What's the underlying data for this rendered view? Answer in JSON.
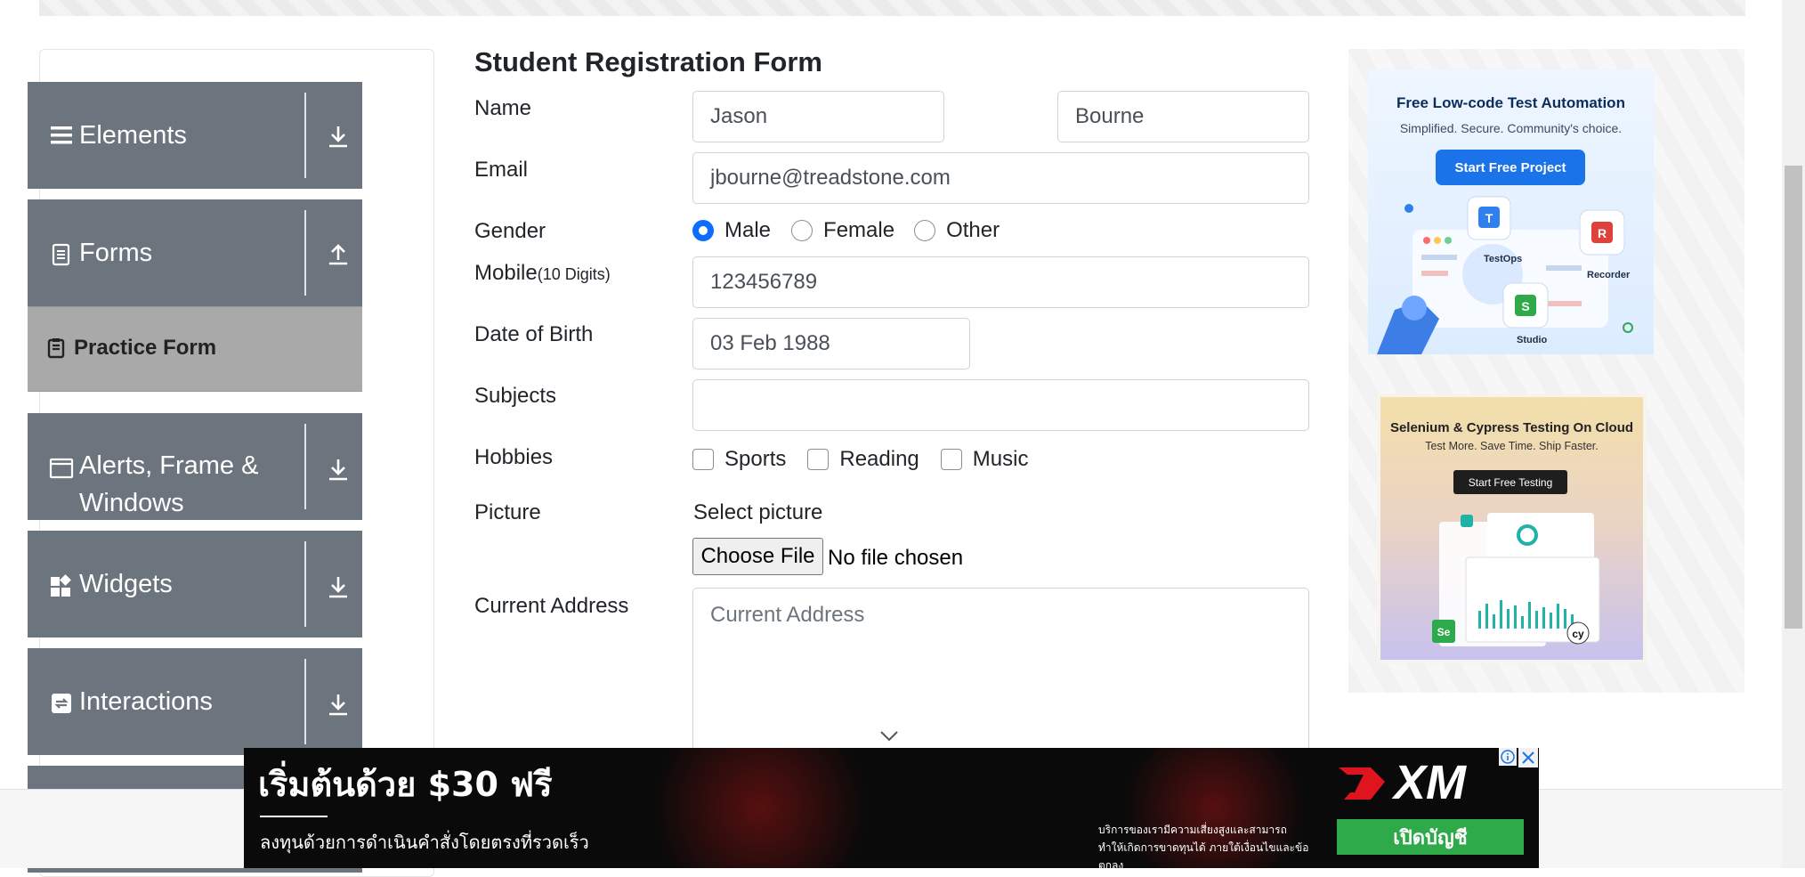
{
  "sidebar": {
    "groups": [
      {
        "label": "Elements",
        "icon": "hamburger-icon",
        "arrow": "download-arrow-icon"
      },
      {
        "label": "Forms",
        "icon": "document-icon",
        "arrow": "upload-arrow-icon"
      },
      {
        "label": "Alerts, Frame & Windows",
        "icon": "window-icon",
        "arrow": "download-arrow-icon"
      },
      {
        "label": "Widgets",
        "icon": "widgets-icon",
        "arrow": "download-arrow-icon"
      },
      {
        "label": "Interactions",
        "icon": "interactions-icon",
        "arrow": "download-arrow-icon"
      }
    ],
    "forms_items": [
      {
        "label": "Practice Form",
        "icon": "clipboard-icon",
        "active": true
      }
    ],
    "alerts_line1": "Alerts, Frame &",
    "alerts_line2": "Windows"
  },
  "form": {
    "title": "Student Registration Form",
    "labels": {
      "name": "Name",
      "email": "Email",
      "gender": "Gender",
      "mobile": "Mobile",
      "mobile_hint": "(10 Digits)",
      "dob": "Date of Birth",
      "subjects": "Subjects",
      "hobbies": "Hobbies",
      "picture": "Picture",
      "address": "Current Address"
    },
    "first_name": "Jason",
    "last_name": "Bourne",
    "email": "jbourne@treadstone.com",
    "gender_options": [
      "Male",
      "Female",
      "Other"
    ],
    "gender_selected": "Male",
    "mobile": "123456789",
    "dob": "03 Feb 1988",
    "subjects": "",
    "hobbies": [
      "Sports",
      "Reading",
      "Music"
    ],
    "select_picture": "Select picture",
    "choose_file": "Choose File",
    "no_file": "No file chosen",
    "address_placeholder": "Current Address"
  },
  "ads": {
    "ad1": {
      "headline": "Free Low-code Test Automation",
      "sub": "Simplified. Secure. Community's choice.",
      "button": "Start Free Project",
      "tags": [
        "TestOps",
        "Recorder",
        "Studio"
      ]
    },
    "ad2": {
      "headline": "Selenium & Cypress Testing On Cloud",
      "sub": "Test More. Save Time. Ship Faster.",
      "button": "Start Free Testing"
    }
  },
  "banner": {
    "headline": "เริ่มต้นด้วย $30 ฟรี",
    "sub": "ลงทุนด้วยการดำเนินคำสั่งโดยตรงที่รวดเร็ว",
    "fine_print": "บริการของเรามีความเสี่ยงสูงและสามารถทำให้เกิดการขาดทุนได้ ภายใต้เงื่อนไขและข้อตกลง",
    "logo": "XM",
    "cta": "เปิดบัญชี"
  },
  "colors": {
    "sidebar_group": "#6c757d",
    "sidebar_active": "#a9a9a9",
    "radio_selected": "#0d6efd",
    "banner_cta": "#2eaa4a"
  }
}
